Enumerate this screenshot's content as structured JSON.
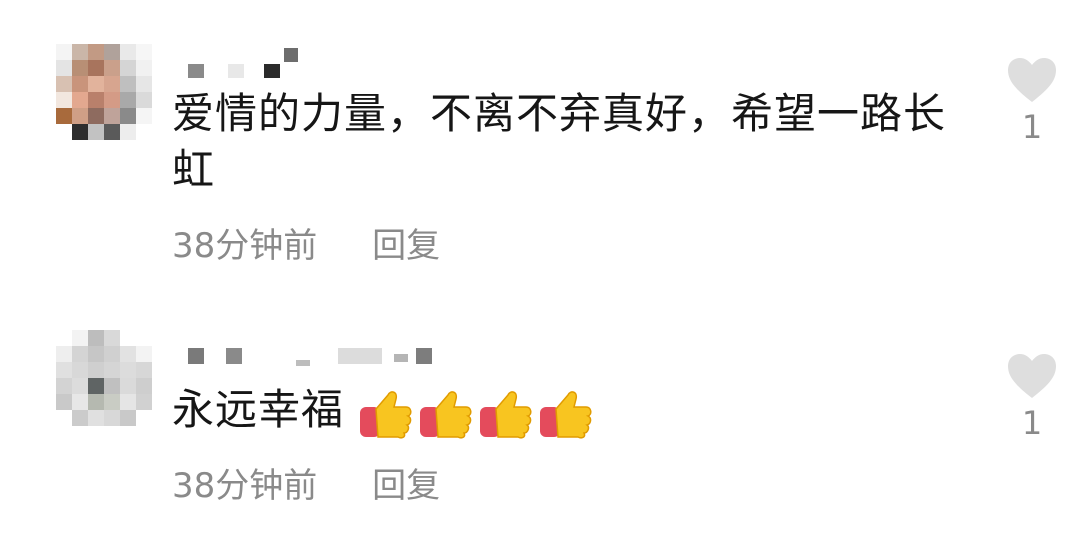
{
  "comments": [
    {
      "text": "爱情的力量，不离不弃真好，希望一路长\n虹",
      "text_line1": "爱情的力量，不离不弃真好，希望一路长",
      "text_line2": "虹",
      "time": "38分钟前",
      "reply_label": "回复",
      "likes": "1",
      "avatar_icon": "pixelated-avatar"
    },
    {
      "text": "永远幸福",
      "emoji": "thumbs-up-icon",
      "emoji_count": 4,
      "time": "38分钟前",
      "reply_label": "回复",
      "likes": "1",
      "avatar_icon": "pixelated-avatar"
    }
  ],
  "colors": {
    "text": "#161616",
    "meta": "#8a8a8a",
    "heart": "#dedede"
  }
}
